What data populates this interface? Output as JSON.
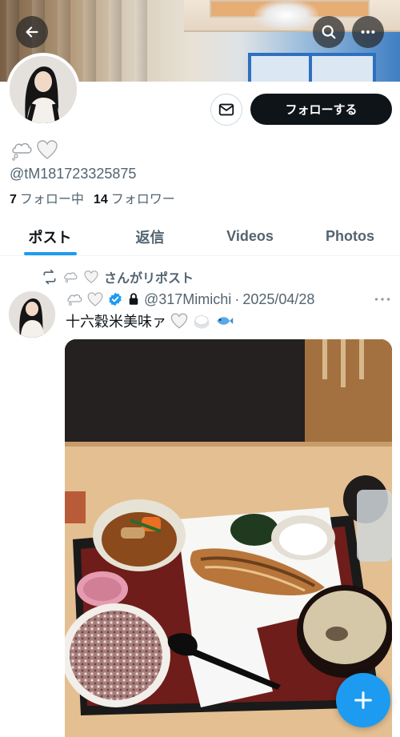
{
  "header": {
    "back_icon": "arrow-left-icon",
    "search_icon": "search-icon",
    "more_icon": "more-horizontal-icon"
  },
  "profile": {
    "display_name_icons": [
      "thought-balloon-icon",
      "white-heart-icon"
    ],
    "handle": "@tM181723325875",
    "following_count": "7",
    "following_label": "フォロー中",
    "followers_count": "14",
    "followers_label": "フォロワー",
    "message_icon": "envelope-icon",
    "follow_label": "フォローする"
  },
  "tabs": [
    {
      "label": "ポスト",
      "active": true
    },
    {
      "label": "返信",
      "active": false
    },
    {
      "label": "Videos",
      "active": false
    },
    {
      "label": "Photos",
      "active": false
    }
  ],
  "post": {
    "repost_icon": "repost-icon",
    "repost_text": "さんがリポスト",
    "author_icons": [
      "thought-balloon-icon",
      "white-heart-icon",
      "verified-badge-icon",
      "lock-icon"
    ],
    "handle": "@317Mimichi",
    "separator": "·",
    "date": "2025/04/28",
    "text": "十六穀米美味ァ",
    "text_emojis": [
      "white-heart-icon",
      "rice-ball-icon",
      "fish-icon"
    ],
    "more_icon": "more-horizontal-icon"
  },
  "fab": {
    "icon": "plus-icon"
  },
  "colors": {
    "accent": "#1d9bf0",
    "text": "#0f1419",
    "muted": "#536471"
  }
}
